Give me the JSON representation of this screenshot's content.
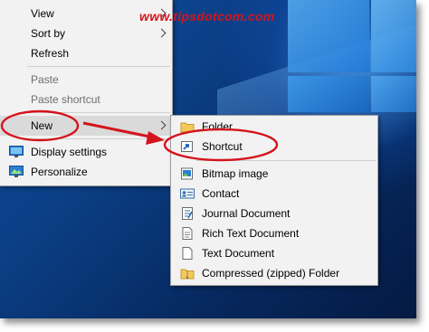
{
  "watermark": "www.tipsdotcom.com",
  "context_menu": {
    "items": [
      {
        "label": "View",
        "submenu": true
      },
      {
        "label": "Sort by",
        "submenu": true
      },
      {
        "label": "Refresh"
      },
      {
        "label": "Paste",
        "disabled": true
      },
      {
        "label": "Paste shortcut",
        "disabled": true
      },
      {
        "label": "New",
        "submenu": true,
        "highlighted": true
      },
      {
        "label": "Display settings",
        "icon": "display-settings-icon"
      },
      {
        "label": "Personalize",
        "icon": "personalize-icon"
      }
    ]
  },
  "new_submenu": {
    "items": [
      {
        "label": "Folder",
        "icon": "folder-icon"
      },
      {
        "label": "Shortcut",
        "icon": "shortcut-icon"
      },
      {
        "label": "Bitmap image",
        "icon": "bitmap-image-icon"
      },
      {
        "label": "Contact",
        "icon": "contact-card-icon"
      },
      {
        "label": "Journal Document",
        "icon": "journal-document-icon"
      },
      {
        "label": "Rich Text Document",
        "icon": "rich-text-document-icon"
      },
      {
        "label": "Text Document",
        "icon": "text-document-icon"
      },
      {
        "label": "Compressed (zipped) Folder",
        "icon": "zipped-folder-icon"
      }
    ]
  },
  "annotations": {
    "color": "#d4141d",
    "circled": [
      "New",
      "Shortcut"
    ],
    "arrow": "from New to Shortcut"
  },
  "colors": {
    "menu_bg": "#f2f2f2",
    "menu_highlight": "#dadada",
    "disabled_text": "#6d6d6d",
    "desktop_blue": "#0b3f86"
  }
}
